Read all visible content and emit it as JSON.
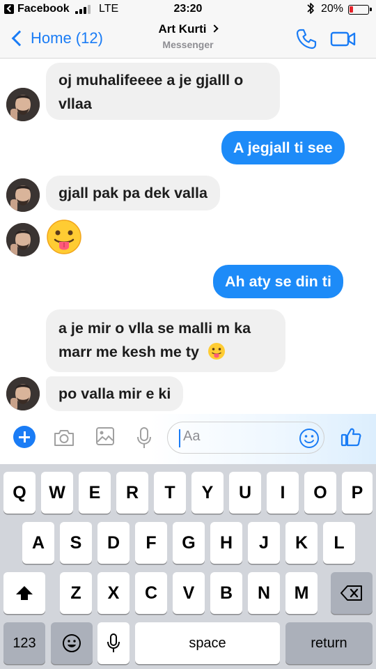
{
  "status_bar": {
    "back_app": "Facebook",
    "network": "LTE",
    "time": "23:20",
    "battery": "20%"
  },
  "header": {
    "back_label": "Home (12)",
    "contact_name": "Art Kurti",
    "subtitle": "Messenger",
    "accent": "#1a7cf5"
  },
  "messages": [
    {
      "sender": "contact",
      "lines": [
        "oj muhalifeeee a je gjalll o",
        "vllaa"
      ]
    },
    {
      "sender": "me",
      "text": "A jegjall ti see"
    },
    {
      "sender": "contact",
      "text": "gjall pak pa dek valla"
    },
    {
      "sender": "contact",
      "emoji": "face-with-tongue"
    },
    {
      "sender": "me",
      "text": "Ah aty se din ti"
    },
    {
      "sender": "contact",
      "lines": [
        "a je mir o vlla se malli m ka",
        "marr me kesh me ty"
      ],
      "trailing_emoji": "face-with-tongue"
    },
    {
      "sender": "contact",
      "text": "po valla mir e ki"
    }
  ],
  "composer": {
    "placeholder": "Aa",
    "icons": [
      "plus-icon",
      "camera-icon",
      "image-icon",
      "microphone-icon",
      "smiley-icon",
      "thumbs-up-icon"
    ]
  },
  "keyboard": {
    "row1": [
      "Q",
      "W",
      "E",
      "R",
      "T",
      "Y",
      "U",
      "I",
      "O",
      "P"
    ],
    "row2": [
      "A",
      "S",
      "D",
      "F",
      "G",
      "H",
      "J",
      "K",
      "L"
    ],
    "row3": [
      "Z",
      "X",
      "C",
      "V",
      "B",
      "N",
      "M"
    ],
    "numbers_key": "123",
    "space_key": "space",
    "return_key": "return"
  },
  "colors": {
    "outgoing_bubble": "#1d8bf8",
    "incoming_bubble": "#f0f0f0",
    "battery_low": "#e8232a"
  }
}
